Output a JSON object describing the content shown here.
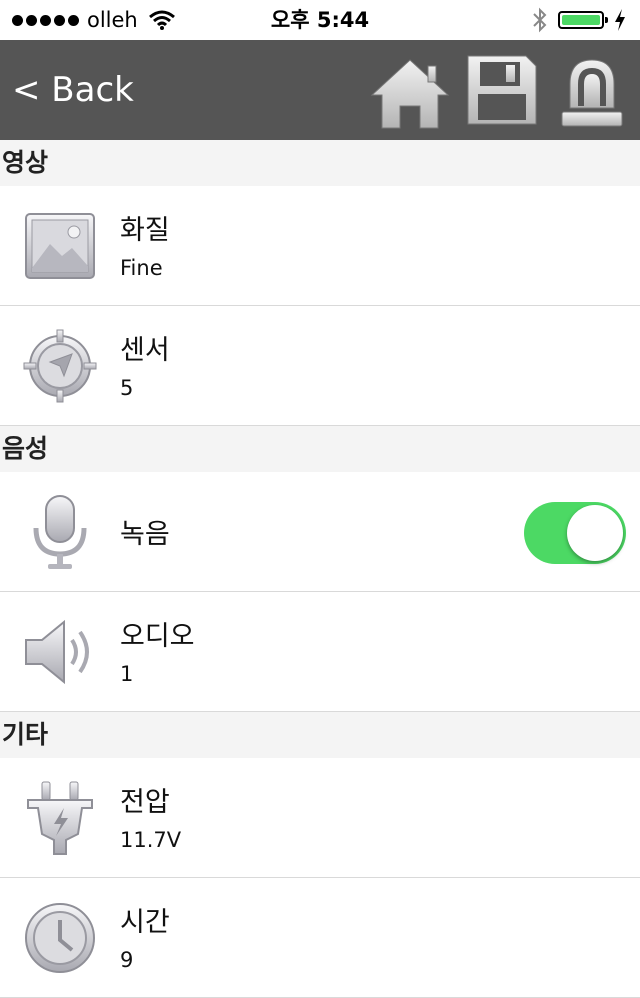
{
  "status_bar": {
    "carrier": "olleh",
    "time": "오후 5:44"
  },
  "nav": {
    "back_label": "< Back",
    "icons": [
      "home-icon",
      "save-icon",
      "alarm-light-icon"
    ]
  },
  "sections": [
    {
      "header": "영상",
      "rows": [
        {
          "icon": "image-icon",
          "label": "화질",
          "value": "Fine"
        },
        {
          "icon": "compass-icon",
          "label": "센서",
          "value": "5"
        }
      ]
    },
    {
      "header": "음성",
      "rows": [
        {
          "icon": "microphone-icon",
          "label": "녹음",
          "toggle": true
        },
        {
          "icon": "speaker-icon",
          "label": "오디오",
          "value": "1"
        }
      ]
    },
    {
      "header": "기타",
      "rows": [
        {
          "icon": "plug-icon",
          "label": "전압",
          "value": "11.7V"
        },
        {
          "icon": "clock-icon",
          "label": "시간",
          "value": "9"
        }
      ]
    }
  ],
  "colors": {
    "nav_background": "#555555",
    "toggle_on": "#4cd964",
    "battery": "#4cd964",
    "section_header_bg": "#f4f4f4"
  }
}
